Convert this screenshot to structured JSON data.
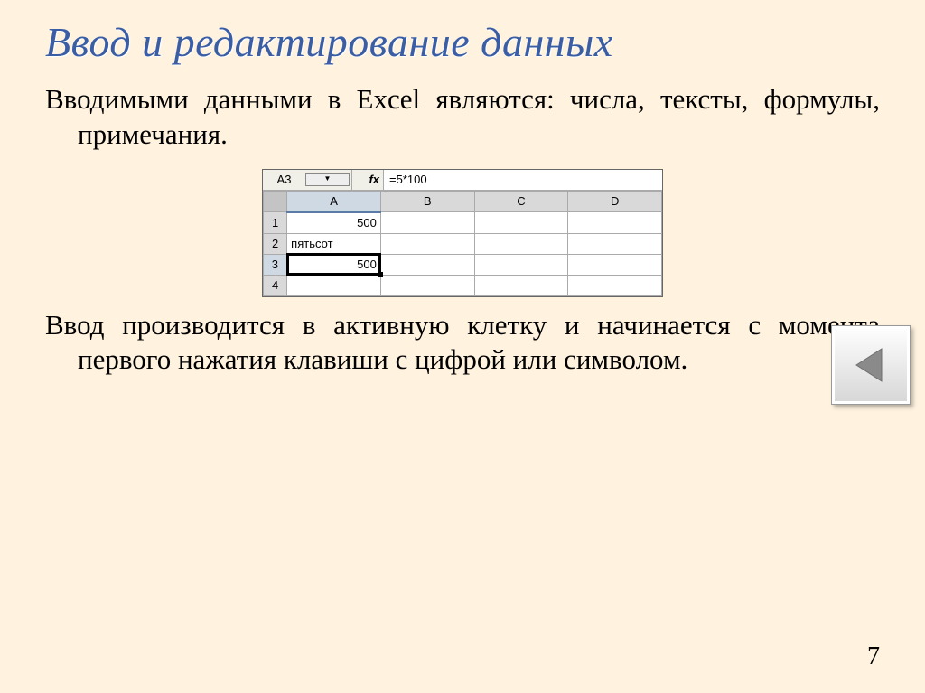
{
  "title": "Ввод и редактирование данных",
  "paragraph1": "Вводимыми данными в Excel являются: числа, тексты, формулы, примечания.",
  "paragraph2": "Ввод производится в активную клетку и начинается с момента первого нажатия клавиши с цифрой или символом.",
  "page_number": "7",
  "excel": {
    "name_box": "A3",
    "fx_label": "fx",
    "formula_value": "=5*100",
    "dropdown_glyph": "▼",
    "columns": [
      "A",
      "B",
      "C",
      "D"
    ],
    "rows": [
      "1",
      "2",
      "3",
      "4"
    ],
    "a1": "500",
    "a2": "пятьсот",
    "a3": "500"
  },
  "icons": {
    "back_arrow": "◀"
  }
}
